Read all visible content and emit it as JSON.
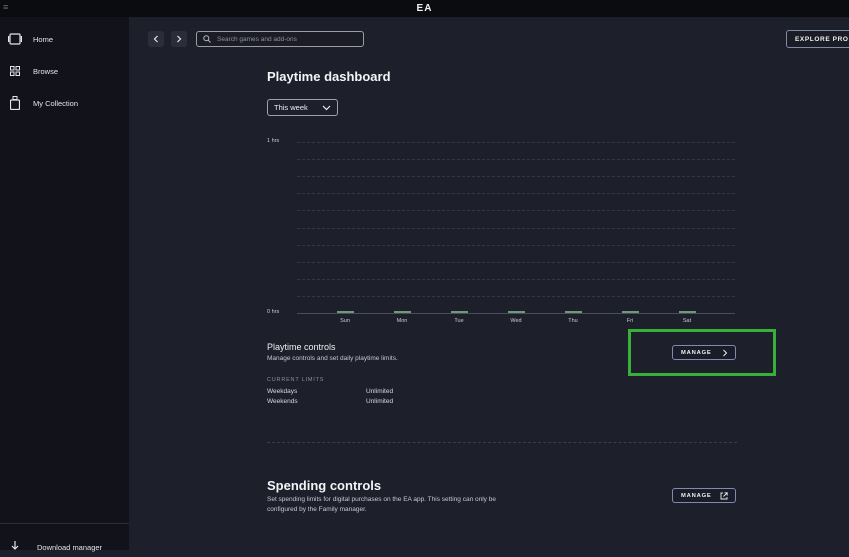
{
  "titlebar": {
    "brand": "EA"
  },
  "sidebar": {
    "items": [
      {
        "label": "Home",
        "icon": "home-icon"
      },
      {
        "label": "Browse",
        "icon": "grid-icon"
      },
      {
        "label": "My Collection",
        "icon": "collection-icon"
      }
    ],
    "download_label": "Download manager"
  },
  "topbar": {
    "search_placeholder": "Search games and add-ons",
    "explore_label": "EXPLORE PRO"
  },
  "dashboard": {
    "title": "Playtime dashboard",
    "range_selected": "This week"
  },
  "chart_data": {
    "type": "bar",
    "categories": [
      "Sun",
      "Mon",
      "Tue",
      "Wed",
      "Thu",
      "Fri",
      "Sat"
    ],
    "values": [
      0,
      0,
      0,
      0,
      0,
      0,
      0
    ],
    "ytick_labels": [
      "1 hrs",
      "0 hrs"
    ],
    "ylim": [
      0,
      1
    ],
    "grid": true,
    "bar_color": "#6f9a78"
  },
  "playtime_controls": {
    "title": "Playtime controls",
    "description": "Manage controls and set daily playtime limits.",
    "manage_label": "MANAGE",
    "limits_heading": "CURRENT LIMITS",
    "limits": [
      {
        "label": "Weekdays",
        "value": "Unlimited"
      },
      {
        "label": "Weekends",
        "value": "Unlimited"
      }
    ]
  },
  "spending_controls": {
    "title": "Spending controls",
    "description_line1": "Set spending limits for digital purchases on the EA app. This setting can only be",
    "description_line2": "configured by the Family manager.",
    "manage_label": "MANAGE"
  },
  "colors": {
    "highlight": "#36b038",
    "background": "#1d1f2b",
    "sidebar": "#12131a"
  }
}
